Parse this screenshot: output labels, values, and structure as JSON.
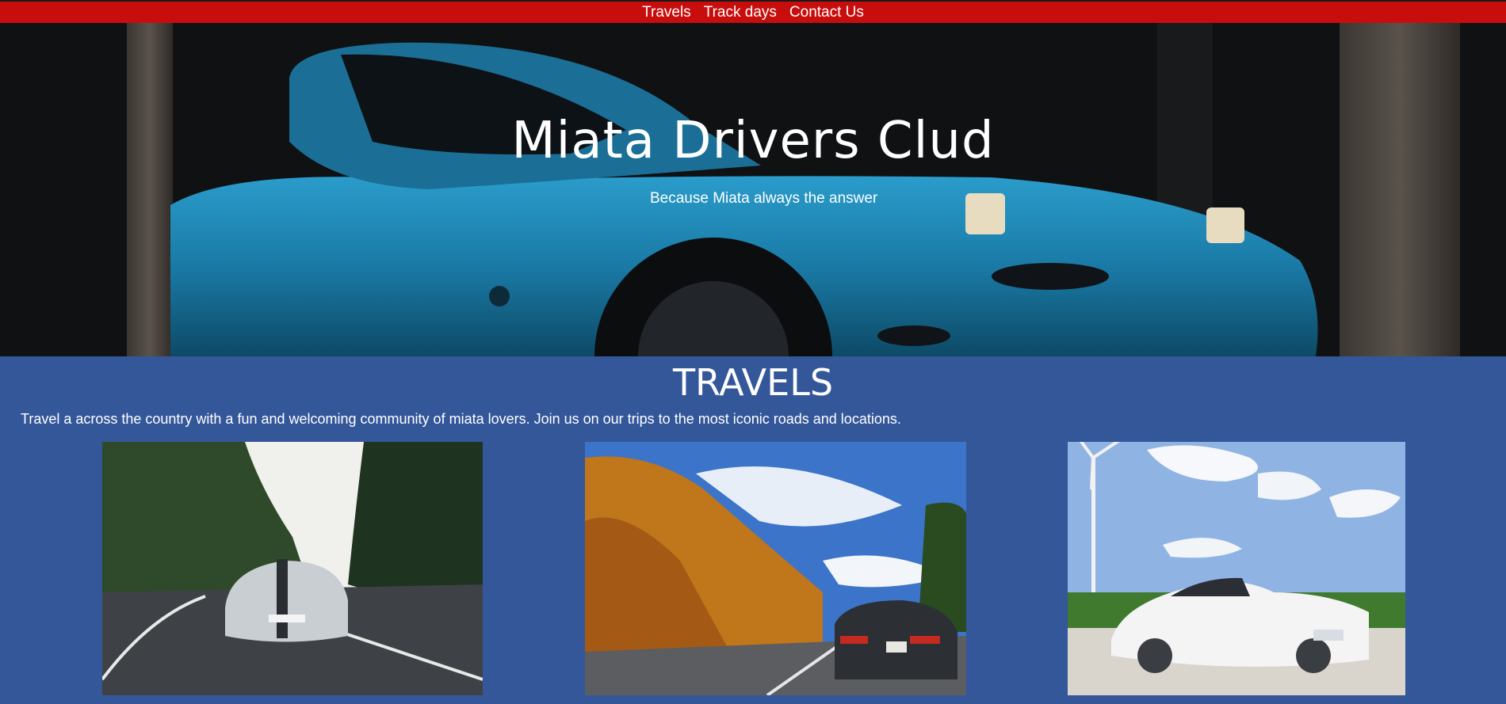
{
  "nav": {
    "items": [
      {
        "label": "Travels"
      },
      {
        "label": "Track days"
      },
      {
        "label": "Contact Us"
      }
    ]
  },
  "hero": {
    "title": "Miata Drivers Clud",
    "subtitle": "Because Miata always the answer"
  },
  "travels": {
    "title": "TRAVELS",
    "description": "Travel a across the country with a fun and welcoming community of miata lovers. Join us on our trips to the most iconic roads and locations."
  },
  "colors": {
    "nav_bg": "#c80d0d",
    "section_bg": "#34579a",
    "hero_car": "#1f7fa8"
  }
}
